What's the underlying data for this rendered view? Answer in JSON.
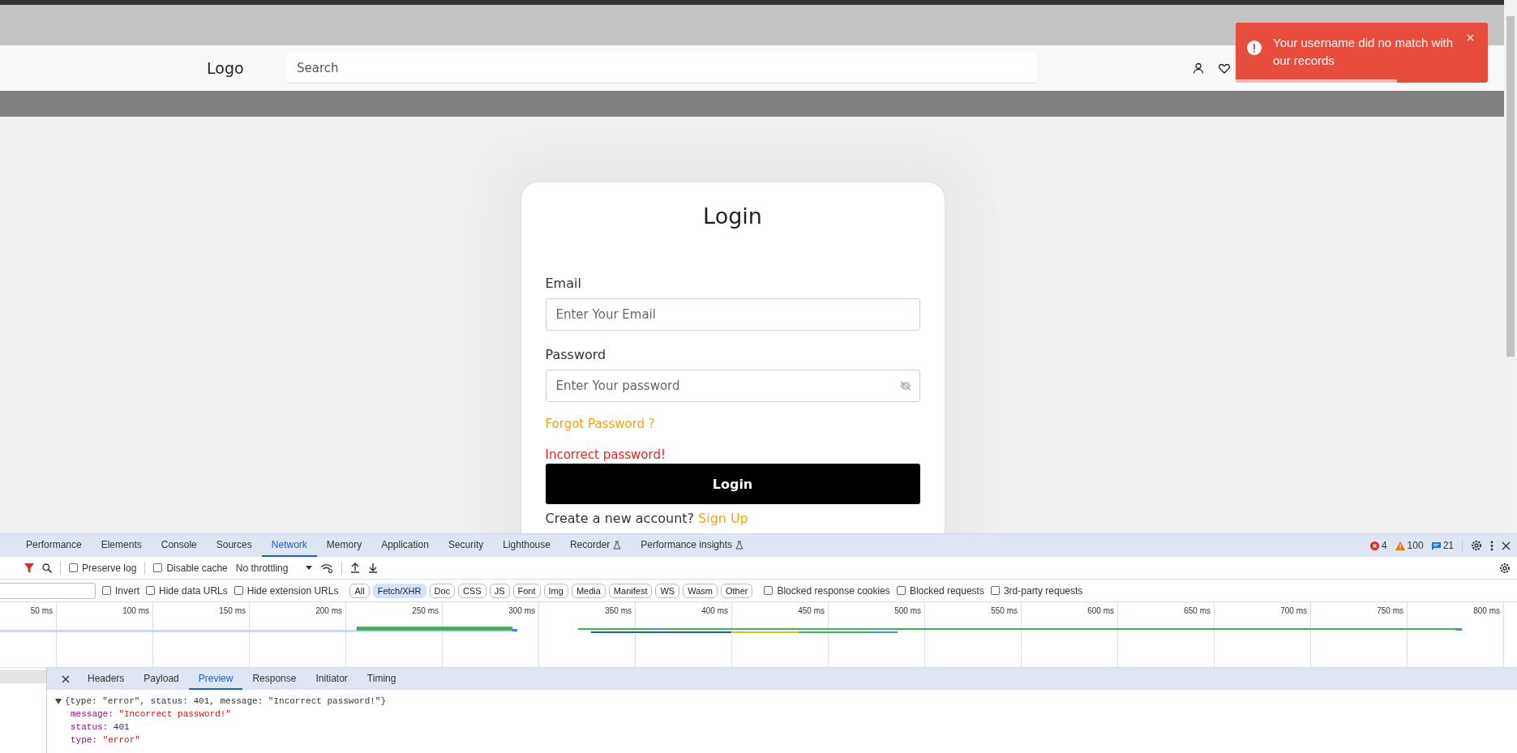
{
  "header": {
    "logo": "Logo",
    "search": {
      "placeholder": "Search"
    }
  },
  "toast": {
    "message": "Your username did no match with our records",
    "level": 0.64
  },
  "login": {
    "title": "Login",
    "fields": [
      {
        "label": "Email",
        "placeholder": "Enter Your Email",
        "kind": "text"
      },
      {
        "label": "Password",
        "placeholder": "Enter Your password",
        "kind": "password"
      }
    ],
    "forgot": "Forgot Password ?",
    "error": "Incorrect password!",
    "button": "Login",
    "signup_text": "Create a new account?",
    "signup_link": "Sign Up"
  },
  "devtools": {
    "tabs": [
      {
        "label": "Performance",
        "selected": false,
        "experimental": false
      },
      {
        "label": "Elements",
        "selected": false,
        "experimental": false
      },
      {
        "label": "Console",
        "selected": false,
        "experimental": false
      },
      {
        "label": "Sources",
        "selected": false,
        "experimental": false
      },
      {
        "label": "Network",
        "selected": true,
        "experimental": false
      },
      {
        "label": "Memory",
        "selected": false,
        "experimental": false
      },
      {
        "label": "Application",
        "selected": false,
        "experimental": false
      },
      {
        "label": "Security",
        "selected": false,
        "experimental": false
      },
      {
        "label": "Lighthouse",
        "selected": false,
        "experimental": false
      },
      {
        "label": "Recorder",
        "selected": false,
        "experimental": true
      },
      {
        "label": "Performance insights",
        "selected": false,
        "experimental": true
      }
    ],
    "counts": {
      "errors": "4",
      "warnings": "100",
      "messages": "21"
    },
    "toolbar": {
      "checkboxes": [
        {
          "label": "Preserve log",
          "checked": false
        },
        {
          "label": "Disable cache",
          "checked": false
        }
      ],
      "throttling": "No throttling"
    },
    "filter": {
      "checkboxes": [
        {
          "label": "Invert",
          "checked": false
        },
        {
          "label": "Hide data URLs",
          "checked": false
        },
        {
          "label": "Hide extension URLs",
          "checked": false
        }
      ],
      "types": [
        {
          "label": "All",
          "selected": false
        },
        {
          "label": "Fetch/XHR",
          "selected": true
        },
        {
          "label": "Doc",
          "selected": false
        },
        {
          "label": "CSS",
          "selected": false
        },
        {
          "label": "JS",
          "selected": false
        },
        {
          "label": "Font",
          "selected": false
        },
        {
          "label": "Img",
          "selected": false
        },
        {
          "label": "Media",
          "selected": false
        },
        {
          "label": "Manifest",
          "selected": false
        },
        {
          "label": "WS",
          "selected": false
        },
        {
          "label": "Wasm",
          "selected": false
        },
        {
          "label": "Other",
          "selected": false
        }
      ],
      "extra_checkboxes": [
        {
          "label": "Blocked response cookies",
          "checked": false
        },
        {
          "label": "Blocked requests",
          "checked": false
        },
        {
          "label": "3rd-party requests",
          "checked": false
        }
      ]
    },
    "timeline_ticks": [
      "50 ms",
      "100 ms",
      "150 ms",
      "200 ms",
      "250 ms",
      "300 ms",
      "350 ms",
      "400 ms",
      "450 ms",
      "500 ms",
      "550 ms",
      "600 ms",
      "650 ms",
      "700 ms",
      "750 ms",
      "800 ms"
    ],
    "detail_tabs": [
      {
        "label": "Headers",
        "selected": false
      },
      {
        "label": "Payload",
        "selected": false
      },
      {
        "label": "Preview",
        "selected": true
      },
      {
        "label": "Response",
        "selected": false
      },
      {
        "label": "Initiator",
        "selected": false
      },
      {
        "label": "Timing",
        "selected": false
      }
    ],
    "preview": {
      "summary": "{type: \"error\", status: 401, message: \"Incorrect password!\"}",
      "expanded": true,
      "properties": [
        {
          "key": "message:",
          "value": "\"Incorrect password!\"",
          "kind": "string"
        },
        {
          "key": "status:",
          "value": "401",
          "kind": "number"
        },
        {
          "key": "type:",
          "value": "\"error\"",
          "kind": "string"
        }
      ]
    }
  }
}
